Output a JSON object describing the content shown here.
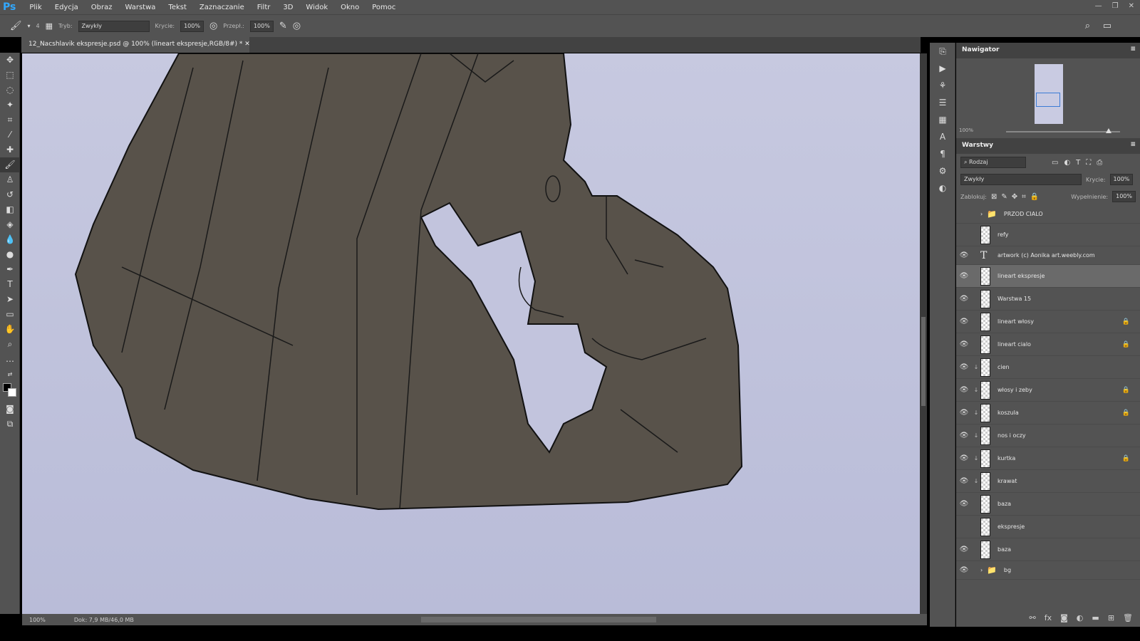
{
  "app": {
    "logo": "Ps",
    "menu": [
      "Plik",
      "Edycja",
      "Obraz",
      "Warstwa",
      "Tekst",
      "Zaznaczanie",
      "Filtr",
      "3D",
      "Widok",
      "Okno",
      "Pomoc"
    ]
  },
  "options": {
    "size": "4",
    "mode_label": "Tryb:",
    "mode": "Zwykły",
    "opacity_label": "Krycie:",
    "opacity": "100%",
    "flow_label": "Przepł.:",
    "flow": "100%"
  },
  "document": {
    "tab": "12_Nacshlavik ekspresje.psd @ 100% (lineart ekspresje,RGB/8#) *"
  },
  "status": {
    "zoom": "100%",
    "doc": "Dok: 7,9 MB/46,0 MB"
  },
  "navigator": {
    "title": "Nawigator",
    "zoom": "100%"
  },
  "layers": {
    "title": "Warstwy",
    "filter": "Rodzaj",
    "blend": "Zwykły",
    "opacity_label": "Krycie:",
    "opacity": "100%",
    "lock_label": "Zablokuj:",
    "fill_label": "Wypełnienie:",
    "fill": "100%",
    "items": [
      {
        "name": "PRZOD CIALO",
        "type": "group",
        "visible": false
      },
      {
        "name": "refy",
        "type": "pixel",
        "visible": false
      },
      {
        "name": "artwork (c) Aonika art.weebly.com",
        "type": "text",
        "visible": true
      },
      {
        "name": "lineart ekspresje",
        "type": "pixel",
        "visible": true,
        "selected": true
      },
      {
        "name": "Warstwa 15",
        "type": "pixel",
        "visible": true
      },
      {
        "name": "lineart włosy",
        "type": "pixel",
        "visible": true,
        "locked": true
      },
      {
        "name": "lineart cialo",
        "type": "pixel",
        "visible": true,
        "locked": true
      },
      {
        "name": "cien",
        "type": "pixel",
        "visible": true,
        "clip": true
      },
      {
        "name": "włosy i zeby",
        "type": "pixel",
        "visible": true,
        "clip": true,
        "locked": true
      },
      {
        "name": "koszula",
        "type": "pixel",
        "visible": true,
        "clip": true,
        "locked": true
      },
      {
        "name": "nos i oczy",
        "type": "pixel",
        "visible": true,
        "clip": true
      },
      {
        "name": "kurtka",
        "type": "pixel",
        "visible": true,
        "clip": true,
        "locked": true
      },
      {
        "name": "krawat",
        "type": "pixel",
        "visible": true,
        "clip": true
      },
      {
        "name": "baza",
        "type": "pixel",
        "visible": true
      },
      {
        "name": "ekspresje",
        "type": "pixel",
        "visible": false
      },
      {
        "name": "baza",
        "type": "pixel",
        "visible": true
      },
      {
        "name": "bg",
        "type": "group",
        "visible": true
      }
    ]
  },
  "colors": {
    "canvas_bg": "#c0c2dc",
    "fill": "#58524a",
    "panel": "#535353",
    "selected": "#6a6a6a"
  }
}
